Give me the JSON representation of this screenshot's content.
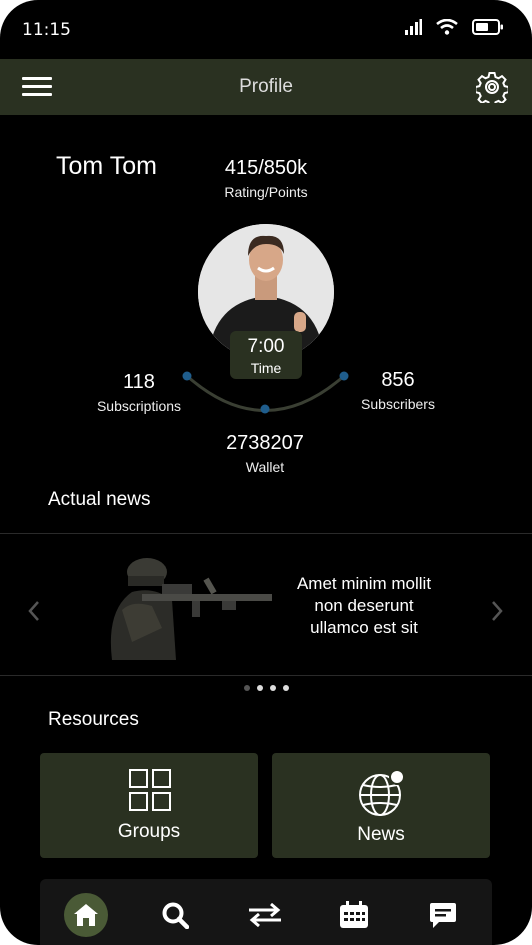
{
  "status_bar": {
    "time": "11:15",
    "icons": [
      "signal-icon",
      "wifi-icon",
      "battery-icon"
    ]
  },
  "header": {
    "title": "Profile",
    "menu_icon": "hamburger-menu-icon",
    "settings_icon": "gear-icon"
  },
  "profile": {
    "name": "Tom Tom",
    "rating_value": "415/850k",
    "rating_label": "Rating/Points",
    "time_value": "7:00",
    "time_label": "Time",
    "subscriptions_value": "118",
    "subscriptions_label": "Subscriptions",
    "subscribers_value": "856",
    "subscribers_label": "Subscribers",
    "wallet_value": "2738207",
    "wallet_label": "Wallet"
  },
  "news": {
    "section_title": "Actual news",
    "slide_text": "Amet minim mollit non deserunt ullamco est sit",
    "slide_count": 4,
    "active_slide": 0
  },
  "resources": {
    "section_title": "Resources",
    "cards": [
      {
        "label": "Groups",
        "icon": "grid-icon"
      },
      {
        "label": "News",
        "icon": "globe-icon"
      }
    ]
  },
  "bottom_nav": {
    "items": [
      "home-icon",
      "search-icon",
      "transfer-icon",
      "calendar-icon",
      "chat-icon"
    ],
    "active": "home"
  },
  "colors": {
    "background": "#000000",
    "panel": "#2a3121",
    "accent": "#4a5a36",
    "dot_blue": "#1f5d8c"
  }
}
